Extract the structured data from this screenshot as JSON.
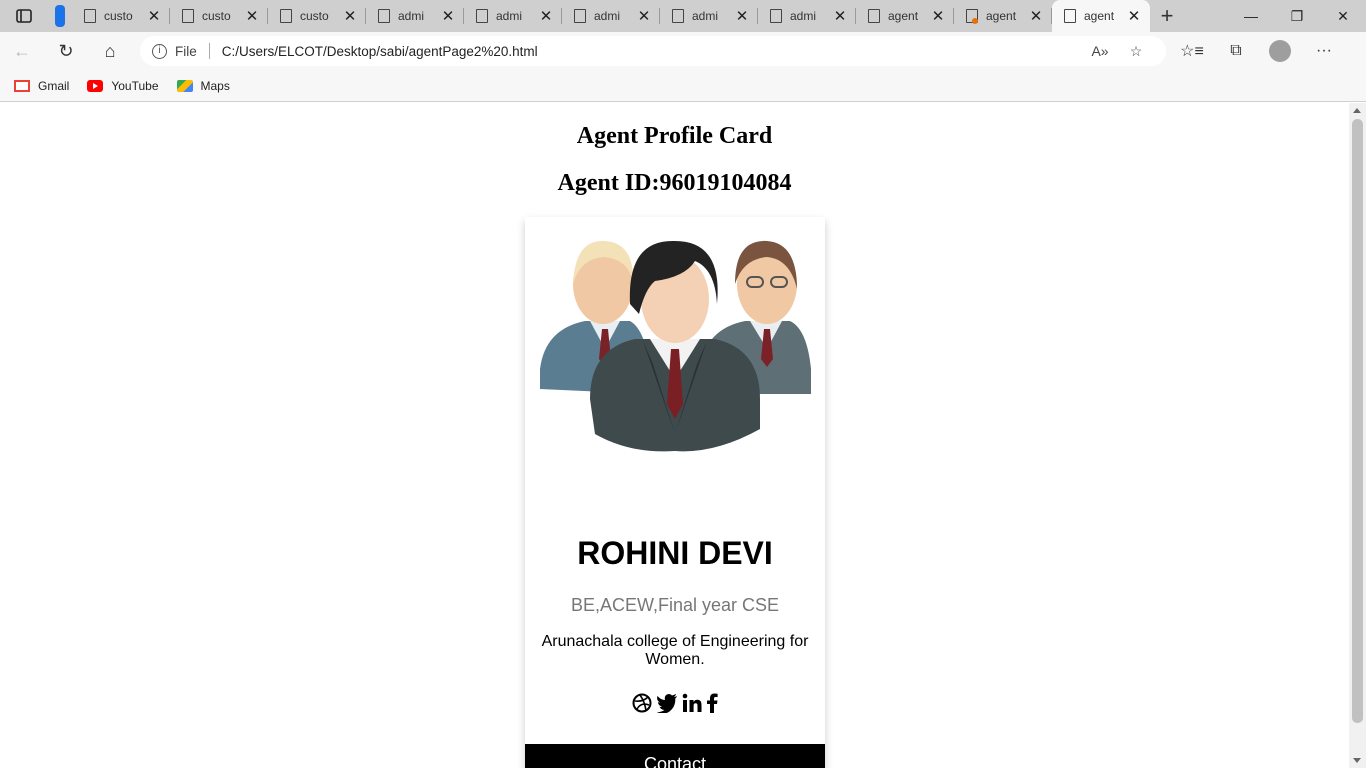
{
  "browser": {
    "tabs": [
      {
        "title": "custo",
        "active": false
      },
      {
        "title": "custo",
        "active": false
      },
      {
        "title": "custo",
        "active": false
      },
      {
        "title": "admi",
        "active": false
      },
      {
        "title": "admi",
        "active": false
      },
      {
        "title": "admi",
        "active": false
      },
      {
        "title": "admi",
        "active": false
      },
      {
        "title": "admi",
        "active": false
      },
      {
        "title": "agent",
        "active": false
      },
      {
        "title": "agent",
        "active": false
      },
      {
        "title": "agent",
        "active": true
      }
    ],
    "address": {
      "scheme_label": "File",
      "url": "C:/Users/ELCOT/Desktop/sabi/agentPage2%20.html"
    },
    "bookmarks": [
      {
        "label": "Gmail",
        "icon": "gmail-icon"
      },
      {
        "label": "YouTube",
        "icon": "youtube-icon"
      },
      {
        "label": "Maps",
        "icon": "maps-icon"
      }
    ]
  },
  "page": {
    "title": "Agent Profile Card",
    "agent_id": "Agent ID:96019104084",
    "card": {
      "name": "ROHINI DEVI",
      "degree": "BE,ACEW,Final year CSE",
      "college": "Arunachala college of Engineering for Women.",
      "social": [
        "dribbble-icon",
        "twitter-icon",
        "linkedin-icon",
        "facebook-icon"
      ],
      "contact_label": "Contact"
    }
  }
}
